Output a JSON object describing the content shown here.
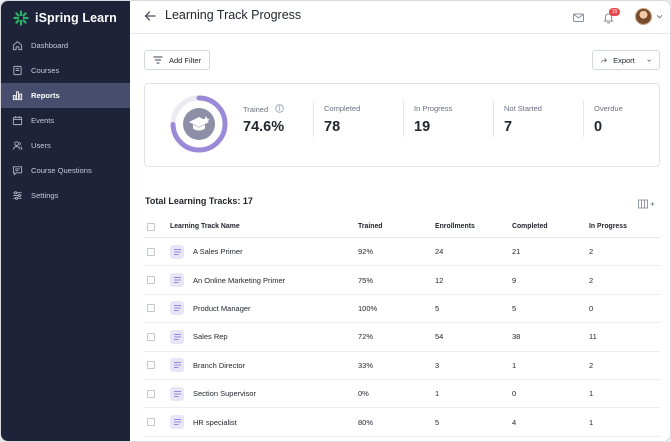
{
  "app": {
    "name": "iSpring Learn",
    "brand_color": "#2fb36b"
  },
  "sidebar": {
    "items": [
      {
        "label": "Dashboard",
        "icon": "home-icon"
      },
      {
        "label": "Courses",
        "icon": "book-icon"
      },
      {
        "label": "Reports",
        "icon": "bar-chart-icon",
        "active": true
      },
      {
        "label": "Events",
        "icon": "calendar-icon"
      },
      {
        "label": "Users",
        "icon": "users-icon"
      },
      {
        "label": "Course Questions",
        "icon": "chat-icon"
      },
      {
        "label": "Settings",
        "icon": "sliders-icon"
      }
    ]
  },
  "header": {
    "title": "Learning Track Progress",
    "notification_count": "15"
  },
  "toolbar": {
    "add_filter_label": "Add Filter",
    "export_label": "Export"
  },
  "stats": {
    "trained_label": "Trained",
    "trained_value": "74.6%",
    "trained_fraction": 0.746,
    "completed_label": "Completed",
    "completed_value": "78",
    "in_progress_label": "In Progress",
    "in_progress_value": "19",
    "not_started_label": "Not Started",
    "not_started_value": "7",
    "overdue_label": "Overdue",
    "overdue_value": "0",
    "accent_color": "#9b8ad8"
  },
  "table": {
    "total_label": "Total Learning Tracks: 17",
    "columns": [
      "Learning Track Name",
      "Trained",
      "Enrollments",
      "Completed",
      "In Progress"
    ],
    "rows": [
      {
        "name": "A Sales Primer",
        "trained": "92%",
        "enrollments": "24",
        "completed": "21",
        "in_progress": "2"
      },
      {
        "name": "An Online Marketing Primer",
        "trained": "75%",
        "enrollments": "12",
        "completed": "9",
        "in_progress": "2"
      },
      {
        "name": "Product Manager",
        "trained": "100%",
        "enrollments": "5",
        "completed": "5",
        "in_progress": "0"
      },
      {
        "name": "Sales Rep",
        "trained": "72%",
        "enrollments": "54",
        "completed": "38",
        "in_progress": "11"
      },
      {
        "name": "Branch Director",
        "trained": "33%",
        "enrollments": "3",
        "completed": "1",
        "in_progress": "2"
      },
      {
        "name": "Section Supervisor",
        "trained": "0%",
        "enrollments": "1",
        "completed": "0",
        "in_progress": "1"
      },
      {
        "name": "HR specialist",
        "trained": "80%",
        "enrollments": "5",
        "completed": "4",
        "in_progress": "1"
      }
    ]
  }
}
